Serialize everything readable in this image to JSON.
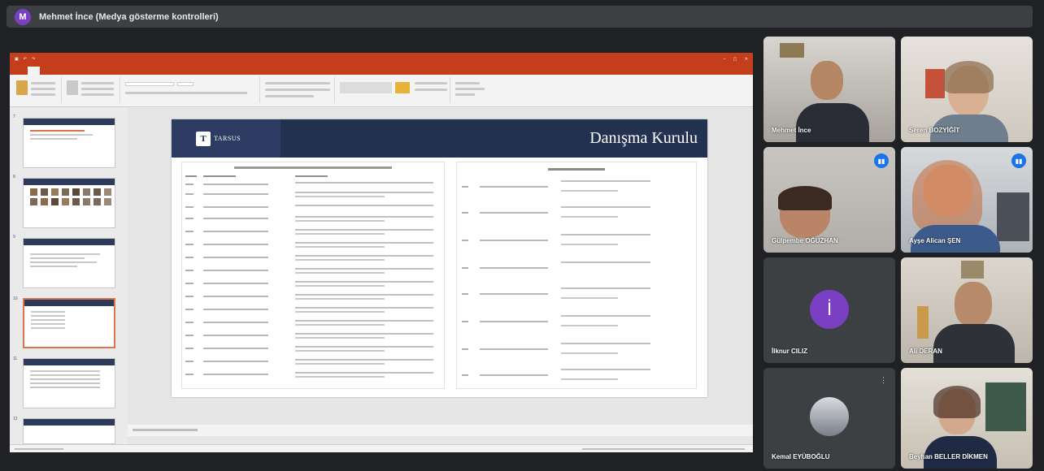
{
  "meeting": {
    "presenter_initial": "M",
    "presenter_title": "Mehmet İnce (Medya gösterme kontrolleri)"
  },
  "slide": {
    "title": "Danışma Kurulu",
    "logo_text": "TARSUS",
    "logo_glyph": "T"
  },
  "participants": [
    {
      "name": "Mehmet İnce"
    },
    {
      "name": "Seren BOZYİĞİT"
    },
    {
      "name": "Gülpembe OĞUZHAN"
    },
    {
      "name": "Ayşe Alican ŞEN"
    },
    {
      "name": "İlknur CILIZ",
      "initial": "İ"
    },
    {
      "name": "Ali DERAN"
    },
    {
      "name": "Kemal EYÜBOĞLU"
    },
    {
      "name": "Beyhan BELLER DİKMEN"
    }
  ],
  "colors": {
    "ppt_accent": "#c43e1c",
    "slide_header": "#243252",
    "speaking_outline": "#8ab4f8",
    "avatar_purple": "#7b3fc4"
  },
  "icons": {
    "mic_active": "mic-active-icon",
    "mic_muted": "mic-muted-icon"
  }
}
